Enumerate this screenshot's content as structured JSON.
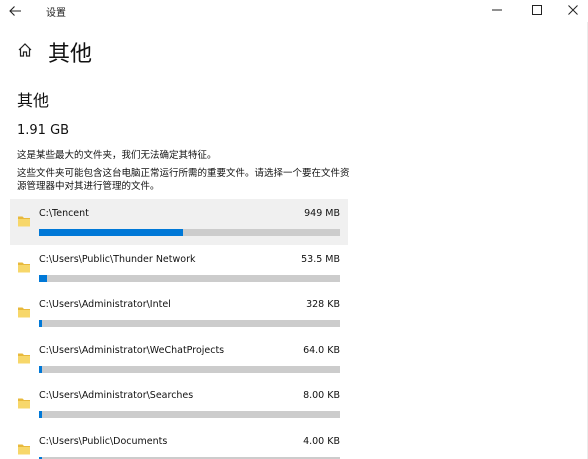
{
  "window": {
    "title": "设置",
    "back_icon": "arrow-left-icon",
    "controls": [
      "minimize-icon",
      "maximize-icon",
      "close-icon"
    ]
  },
  "page": {
    "title": "其他",
    "home_icon": "home-icon"
  },
  "section": {
    "title": "其他",
    "total_size": "1.91 GB",
    "desc1": "这是某些最大的文件夹，我们无法确定其特征。",
    "desc2": "这些文件夹可能包含这台电脑正常运行所需的重要文件。请选择一个要在文件资源管理器中对其进行管理的文件。"
  },
  "colors": {
    "accent": "#0078d7",
    "bar_track": "#cccccc",
    "selected_row": "#f0f0f0"
  },
  "folders": [
    {
      "path": "C:\\Tencent",
      "size": "949 MB",
      "usage_fraction": 0.48,
      "selected": true
    },
    {
      "path": "C:\\Users\\Public\\Thunder Network",
      "size": "53.5 MB",
      "usage_fraction": 0.027
    },
    {
      "path": "C:\\Users\\Administrator\\Intel",
      "size": "328 KB",
      "usage_fraction": 0.01
    },
    {
      "path": "C:\\Users\\Administrator\\WeChatProjects",
      "size": "64.0 KB",
      "usage_fraction": 0.01
    },
    {
      "path": "C:\\Users\\Administrator\\Searches",
      "size": "8.00 KB",
      "usage_fraction": 0.01
    },
    {
      "path": "C:\\Users\\Public\\Documents",
      "size": "4.00 KB",
      "usage_fraction": 0.01
    }
  ]
}
